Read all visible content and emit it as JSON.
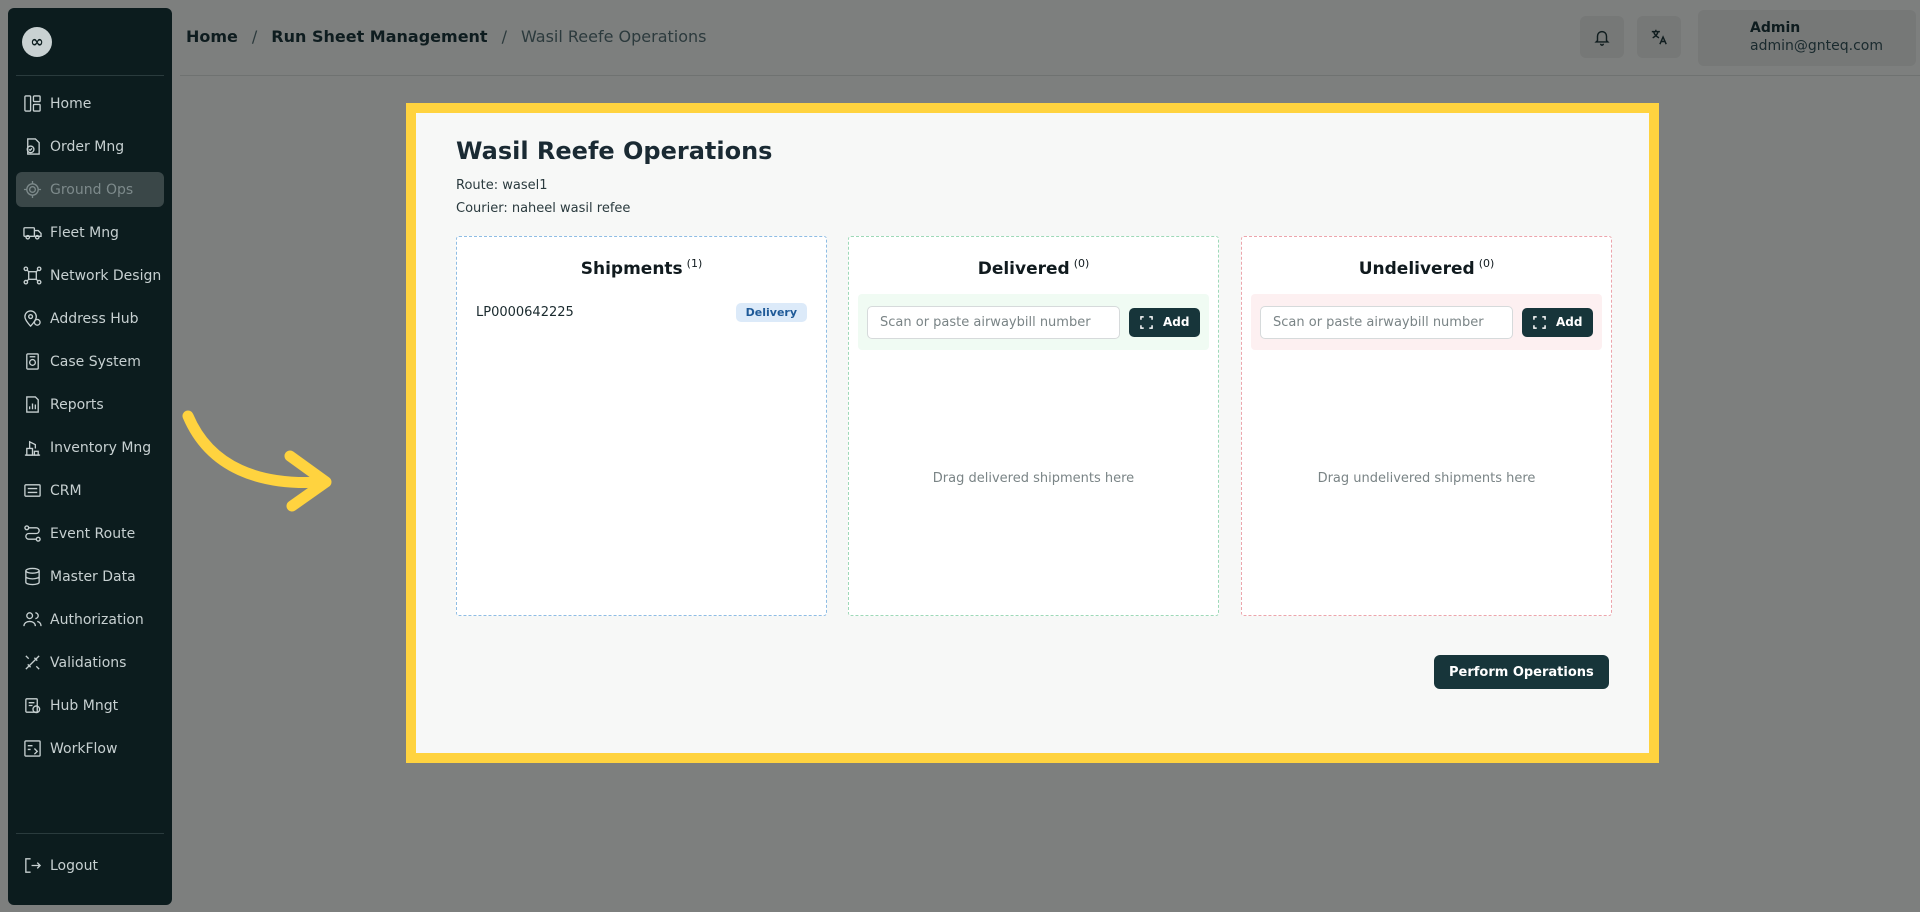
{
  "sidebar": {
    "logo": "∞",
    "items": [
      {
        "label": "Home",
        "icon": "dashboard-icon"
      },
      {
        "label": "Order Mng",
        "icon": "order-icon"
      },
      {
        "label": "Ground Ops",
        "icon": "ground-ops-icon",
        "active": true
      },
      {
        "label": "Fleet Mng",
        "icon": "truck-icon"
      },
      {
        "label": "Network Design",
        "icon": "network-icon"
      },
      {
        "label": "Address Hub",
        "icon": "location-pin-icon"
      },
      {
        "label": "Case System",
        "icon": "case-icon"
      },
      {
        "label": "Reports",
        "icon": "report-icon"
      },
      {
        "label": "Inventory Mng",
        "icon": "inventory-icon"
      },
      {
        "label": "CRM",
        "icon": "crm-icon"
      },
      {
        "label": "Event Route",
        "icon": "route-icon"
      },
      {
        "label": "Master Data",
        "icon": "database-icon"
      },
      {
        "label": "Authorization",
        "icon": "users-icon"
      },
      {
        "label": "Validations",
        "icon": "tools-icon"
      },
      {
        "label": "Hub Mngt",
        "icon": "hub-icon"
      },
      {
        "label": "WorkFlow",
        "icon": "workflow-icon"
      }
    ],
    "logout": "Logout"
  },
  "header": {
    "breadcrumb": [
      "Home",
      "Run Sheet Management",
      "Wasil Reefe Operations"
    ],
    "separator": "/",
    "user": {
      "name": "Admin",
      "email": "admin@gnteq.com"
    }
  },
  "page": {
    "title": "Wasil Reefe Operations",
    "route": "Route: wasel1",
    "courier": "Courier: naheel wasil refee"
  },
  "panels": {
    "shipments": {
      "title": "Shipments",
      "count": "(1)",
      "items": [
        {
          "id": "LP0000642225",
          "badge": "Delivery"
        }
      ]
    },
    "delivered": {
      "title": "Delivered",
      "count": "(0)",
      "placeholder": "Scan or paste airwaybill number",
      "add_label": "Add",
      "hint": "Drag delivered shipments here"
    },
    "undelivered": {
      "title": "Undelivered",
      "count": "(0)",
      "placeholder": "Scan or paste airwaybill number",
      "add_label": "Add",
      "hint": "Drag undelivered shipments here"
    }
  },
  "actions": {
    "perform": "Perform Operations"
  },
  "colors": {
    "highlight": "#ffd33f",
    "sidebar_bg": "#0c1c1e",
    "primary_button": "#17353a",
    "badge_bg": "#dceaf9",
    "badge_text": "#1f5a98"
  }
}
